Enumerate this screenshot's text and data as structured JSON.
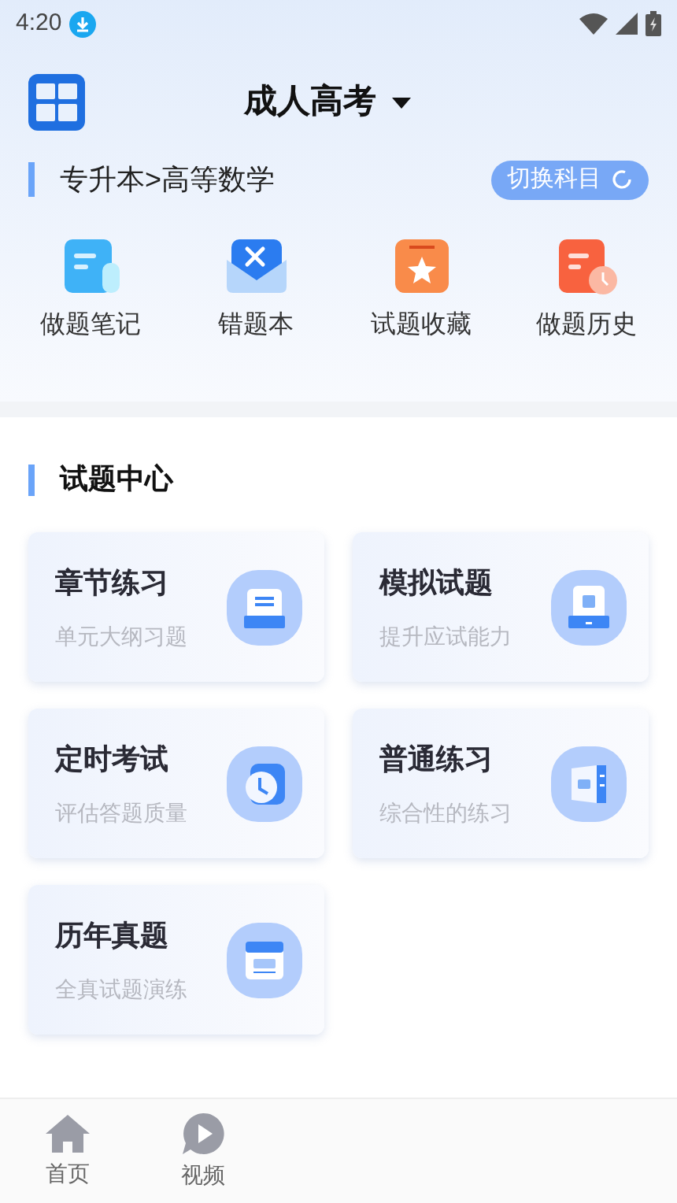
{
  "status_bar": {
    "time": "4:20"
  },
  "header": {
    "title": "成人高考"
  },
  "subject": {
    "path": "专升本>高等数学",
    "switch_button": "切换科目"
  },
  "shortcuts": [
    {
      "kind": "notes",
      "label": "做题笔记"
    },
    {
      "kind": "mistakes",
      "label": "错题本"
    },
    {
      "kind": "favorites",
      "label": "试题收藏"
    },
    {
      "kind": "history",
      "label": "做题历史"
    }
  ],
  "section": {
    "title": "试题中心"
  },
  "cards": [
    {
      "kind": "unit",
      "title": "章节练习",
      "subtitle": "单元大纲习题"
    },
    {
      "kind": "mock",
      "title": "模拟试题",
      "subtitle": "提升应试能力"
    },
    {
      "kind": "timer",
      "title": "定时考试",
      "subtitle": "评估答题质量"
    },
    {
      "kind": "general",
      "title": "普通练习",
      "subtitle": "综合性的练习"
    },
    {
      "kind": "past",
      "title": "历年真题",
      "subtitle": "全真试题演练"
    }
  ],
  "bottom_nav": [
    {
      "kind": "home",
      "label": "首页"
    },
    {
      "kind": "video",
      "label": "视频"
    }
  ]
}
